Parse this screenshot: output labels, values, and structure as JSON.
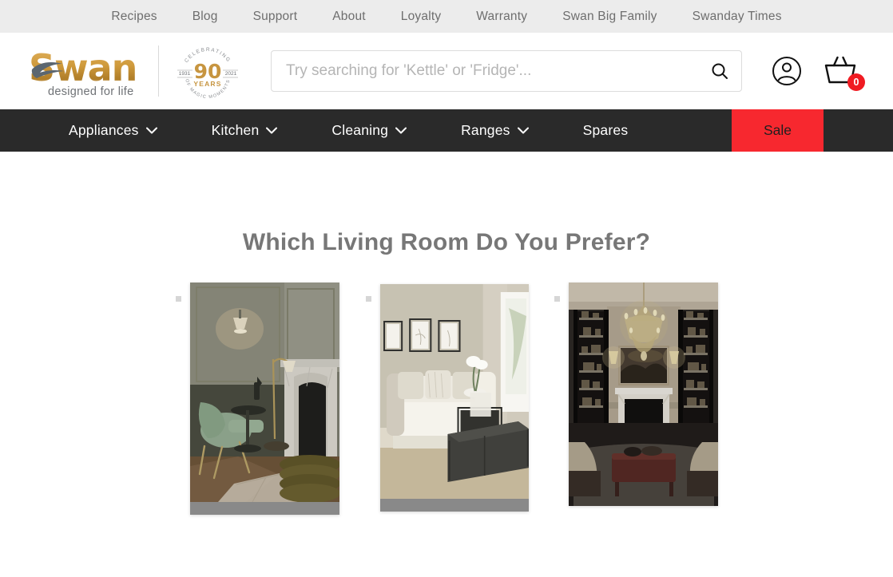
{
  "topbar": {
    "links": [
      {
        "label": "Recipes"
      },
      {
        "label": "Blog"
      },
      {
        "label": "Support"
      },
      {
        "label": "About"
      },
      {
        "label": "Loyalty"
      },
      {
        "label": "Warranty"
      },
      {
        "label": "Swan Big Family"
      },
      {
        "label": "Swanday Times"
      }
    ]
  },
  "header": {
    "logo": {
      "wordmark": "Swan",
      "tagline": "designed for life",
      "icon": "swan-bird-icon"
    },
    "badge": {
      "arc_top": "CELEBRATING",
      "year_from": "1931",
      "year_to": "2021",
      "number": "90",
      "years_label": "YEARS",
      "arc_bottom": "OF MAGIC MOMENTS"
    },
    "search": {
      "placeholder": "Try searching for 'Kettle' or 'Fridge'...",
      "value": "",
      "button_icon": "search-icon"
    },
    "account": {
      "icon": "user-account-icon",
      "label": "Account"
    },
    "cart": {
      "icon": "basket-icon",
      "count": "0",
      "badge_color": "#f01b22"
    }
  },
  "nav": {
    "items": [
      {
        "label": "Appliances",
        "has_dropdown": true
      },
      {
        "label": "Kitchen",
        "has_dropdown": true
      },
      {
        "label": "Cleaning",
        "has_dropdown": true
      },
      {
        "label": "Ranges",
        "has_dropdown": true
      },
      {
        "label": "Spares",
        "has_dropdown": false
      }
    ],
    "sale": {
      "label": "Sale",
      "background": "#f7282f"
    },
    "background": "#2a2a2a"
  },
  "main": {
    "title": "Which Living Room Do You Prefer?",
    "title_color": "#777777",
    "cards": [
      {
        "name": "sage-green-living-room",
        "alt": "Sage green panelled living room with velvet armchair, marble fireplace and wall lamp",
        "has_caption_bar": true
      },
      {
        "name": "neutral-beige-living-room",
        "alt": "Neutral beige living room with white sofa, framed prints and black coffee table",
        "has_caption_bar": true
      },
      {
        "name": "classic-chandelier-living-room",
        "alt": "Classic living room with crystal chandelier, lit bookshelves and white fireplace",
        "has_caption_bar": false
      }
    ]
  }
}
